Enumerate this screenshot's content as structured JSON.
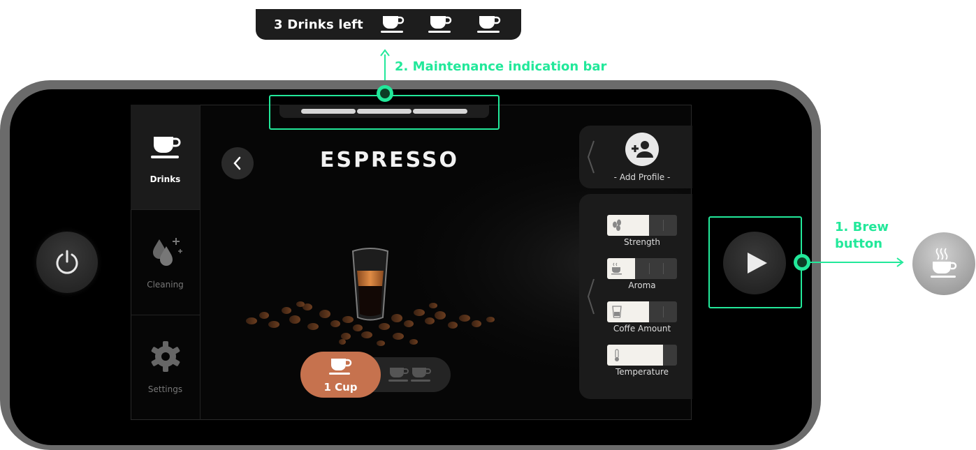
{
  "maintenance_tooltip": {
    "text": "3 Drinks left",
    "cups_remaining": 3
  },
  "annotations": {
    "maintenance": "2. Maintenance indication bar",
    "brew_line1": "1. Brew",
    "brew_line2": "button"
  },
  "sidebar": {
    "items": [
      {
        "label": "Drinks",
        "icon": "cup-icon",
        "active": true
      },
      {
        "label": "Cleaning",
        "icon": "water-drops-icon",
        "active": false
      },
      {
        "label": "Settings",
        "icon": "gear-icon",
        "active": false
      }
    ]
  },
  "main": {
    "title": "ESPRESSO",
    "cup_option": "1 Cup"
  },
  "maintenance_bar": {
    "segments": 3
  },
  "profile": {
    "label": "- Add Profile -"
  },
  "sliders": [
    {
      "label": "Strength",
      "icon": "coffee-beans-icon",
      "level": 0.6
    },
    {
      "label": "Aroma",
      "icon": "steaming-cup-icon",
      "level": 0.4
    },
    {
      "label": "Coffe Amount",
      "icon": "glass-icon",
      "level": 0.6
    },
    {
      "label": "Temperature",
      "icon": "thermometer-icon",
      "level": 0.8
    }
  ],
  "colors": {
    "accent": "#22e89a",
    "cup_active": "#c6724e"
  }
}
